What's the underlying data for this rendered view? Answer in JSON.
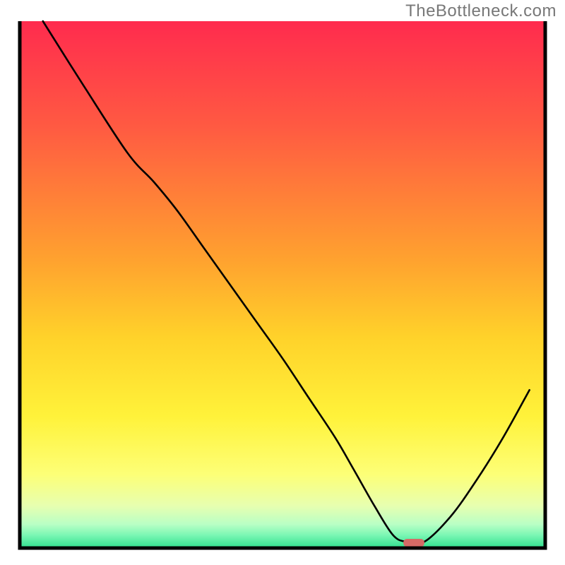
{
  "watermark": "TheBottleneck.com",
  "chart_data": {
    "type": "line",
    "title": "",
    "xlabel": "",
    "ylabel": "",
    "xlim": [
      0,
      100
    ],
    "ylim": [
      0,
      100
    ],
    "grid": false,
    "legend": false,
    "gradient_stops": [
      {
        "offset": 0.0,
        "color": "#ff2b4e"
      },
      {
        "offset": 0.2,
        "color": "#ff5a42"
      },
      {
        "offset": 0.45,
        "color": "#ffa12f"
      },
      {
        "offset": 0.6,
        "color": "#ffd22a"
      },
      {
        "offset": 0.75,
        "color": "#fff23a"
      },
      {
        "offset": 0.86,
        "color": "#fdff77"
      },
      {
        "offset": 0.92,
        "color": "#e7ffb0"
      },
      {
        "offset": 0.955,
        "color": "#b9ffc5"
      },
      {
        "offset": 0.975,
        "color": "#7cf7b4"
      },
      {
        "offset": 1.0,
        "color": "#30e08e"
      }
    ],
    "curve": {
      "name": "bottleneck-curve",
      "x": [
        4.4,
        12,
        20.5,
        25.5,
        30,
        35,
        40,
        45,
        50,
        55,
        60,
        63.5,
        67.5,
        71,
        73.5,
        77,
        82,
        87,
        92,
        97
      ],
      "y": [
        100,
        88,
        75,
        69.5,
        64,
        57,
        50,
        43,
        36,
        28.5,
        21,
        15,
        8,
        2.5,
        1.2,
        1.2,
        6,
        13,
        21,
        30
      ]
    },
    "minimum_marker": {
      "x_start": 73.0,
      "x_end": 77.0,
      "y": 1.0,
      "color": "#d56a66"
    }
  }
}
